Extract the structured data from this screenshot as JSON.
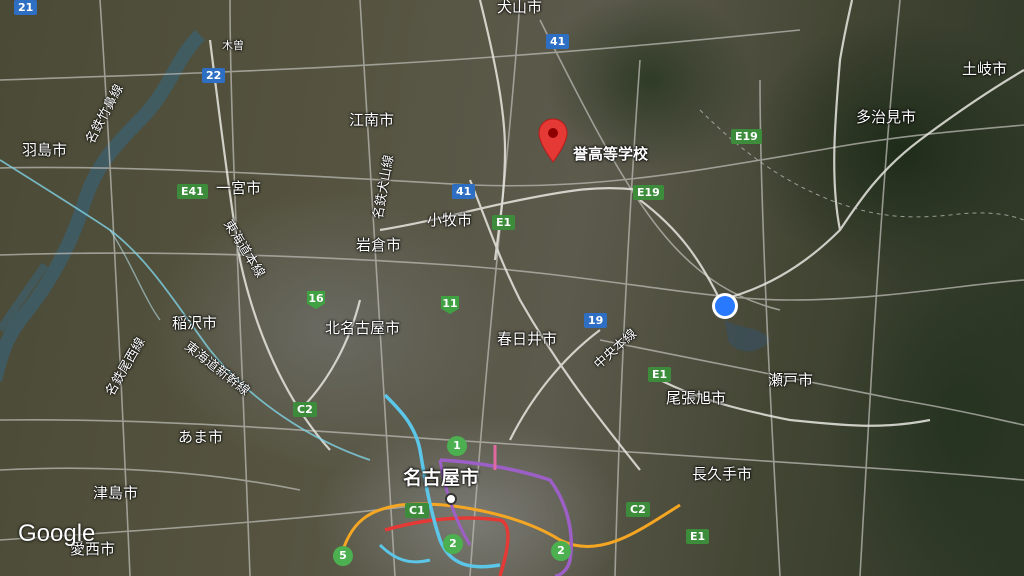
{
  "map": {
    "attribution_logo": "Google",
    "marker": {
      "label": "誉高等学校",
      "icon": "red-map-pin-icon"
    },
    "current_location": {
      "icon": "blue-location-dot-icon"
    },
    "places": {
      "inuyama": "犬山市",
      "toki": "土岐市",
      "tajimi": "多治見市",
      "konan": "江南市",
      "hashima": "羽島市",
      "ichinomiya": "一宮市",
      "komaki": "小牧市",
      "iwakura": "岩倉市",
      "inazawa": "稲沢市",
      "kitanagoya": "北名古屋市",
      "kasugai": "春日井市",
      "owariasahi": "尾張旭市",
      "seto": "瀬戸市",
      "ama": "あま市",
      "nagoya": "名古屋市",
      "nagakute": "長久手市",
      "tsushima": "津島市",
      "aisai": "愛西市"
    },
    "lines": {
      "meitetsu_takehana": "名鉄竹鼻線",
      "meitetsu_inuyama": "名鉄犬山線",
      "tokaido_main": "東海道本線",
      "meitetsu_bisai": "名鉄尾西線",
      "tokaido_shinkansen": "東海道新幹線",
      "chuo_main": "中央本線",
      "kiso": "木曽"
    },
    "shields": {
      "r21": "21",
      "r22": "22",
      "r41a": "41",
      "r41b": "41",
      "r19": "19",
      "e41": "E41",
      "e1a": "E1",
      "e1b": "E1",
      "e1c": "E1",
      "e19a": "E19",
      "e19b": "E19",
      "c1": "C1",
      "c2a": "C2",
      "c2b": "C2",
      "r16": "16",
      "r11": "11",
      "m1": "1",
      "m2a": "2",
      "m2b": "2",
      "m5": "5"
    },
    "colors": {
      "marker": "#e53935",
      "location": "#2979ff",
      "expressway": "#f5a623",
      "metro_red": "#e53935",
      "metro_purple": "#9c5fc6",
      "metro_cyan": "#5bc6e8",
      "river": "#3b5a62"
    }
  }
}
